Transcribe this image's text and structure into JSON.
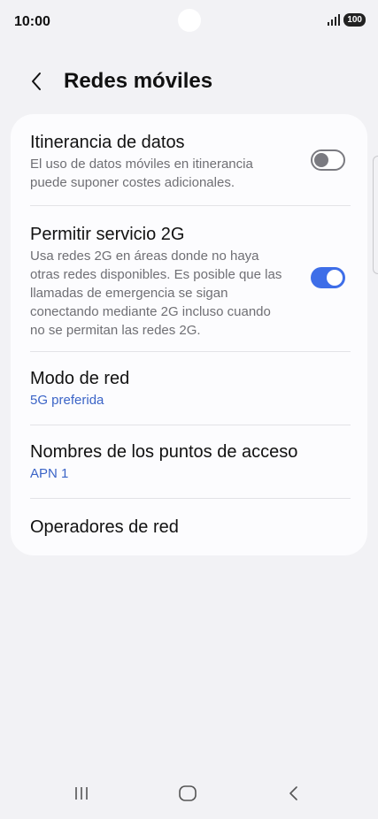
{
  "status_bar": {
    "time": "10:00",
    "battery": "100",
    "signal_icon": "signal-icon"
  },
  "header": {
    "back_icon": "chevron-left-icon",
    "title": "Redes móviles"
  },
  "settings": {
    "items": [
      {
        "title": "Itinerancia de datos",
        "description": "El uso de datos móviles en itinerancia puede suponer costes adicionales.",
        "toggle": "off"
      },
      {
        "title": "Permitir servicio 2G",
        "description": "Usa redes 2G en áreas donde no haya otras redes disponibles. Es posible que las llamadas de emergencia se sigan conectando mediante 2G incluso cuando no se permitan las redes 2G.",
        "toggle": "on"
      },
      {
        "title": "Modo de red",
        "subtitle": "5G preferida"
      },
      {
        "title": "Nombres de los puntos de acceso",
        "subtitle": "APN 1"
      },
      {
        "title": "Operadores de red"
      }
    ]
  },
  "colors": {
    "background": "#f2f2f5",
    "card": "#fcfcfe",
    "accent": "#3e6ee8",
    "link_text": "#3b64c7"
  },
  "nav_bar": {
    "recent_icon": "recent-apps-icon",
    "home_icon": "home-icon",
    "back_icon": "back-icon"
  }
}
